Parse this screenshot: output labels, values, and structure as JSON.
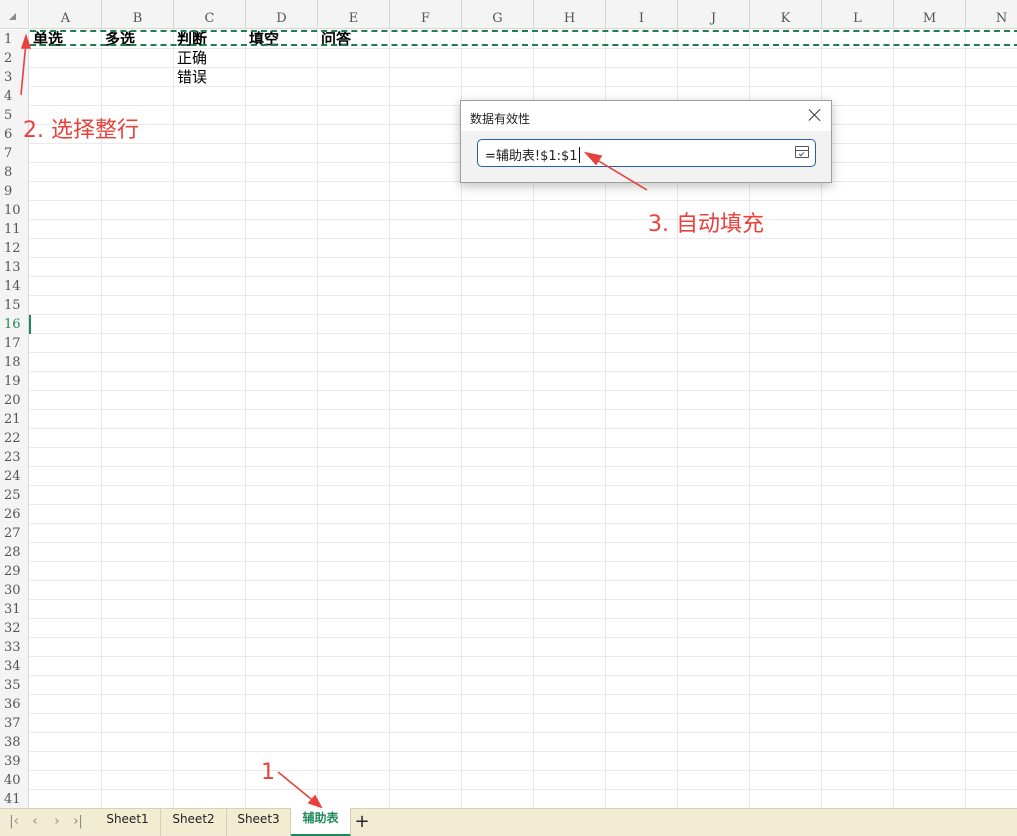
{
  "columns": [
    "A",
    "B",
    "C",
    "D",
    "E",
    "F",
    "G",
    "H",
    "I",
    "J",
    "K",
    "L",
    "M",
    "N"
  ],
  "rows": [
    "1",
    "2",
    "3",
    "4",
    "5",
    "6",
    "7",
    "8",
    "9",
    "10",
    "11",
    "12",
    "13",
    "14",
    "15",
    "16",
    "17",
    "18",
    "19",
    "20",
    "21",
    "22",
    "23",
    "24",
    "25",
    "26",
    "27",
    "28",
    "29",
    "30",
    "31",
    "32",
    "33",
    "34",
    "35",
    "36",
    "37",
    "38",
    "39",
    "40",
    "41"
  ],
  "active_row": "16",
  "cells": {
    "A1": "单选",
    "B1": "多选",
    "C1": "判断",
    "D1": "填空",
    "E1": "问答",
    "C2": "正确",
    "C3": "错误"
  },
  "dialog": {
    "title": "数据有效性",
    "reference": "=辅助表!$1:$1"
  },
  "annotations": {
    "step1": "1",
    "step2": "2. 选择整行",
    "step3": "3. 自动填充",
    "color": "#e8413c"
  },
  "sheet_tabs": [
    "Sheet1",
    "Sheet2",
    "Sheet3",
    "辅助表"
  ],
  "active_tab": "辅助表",
  "nav_icons": [
    "first-sheet-icon",
    "prev-sheet-icon",
    "next-sheet-icon",
    "last-sheet-icon"
  ],
  "add_sheet_label": "+",
  "accent_color": "#1e8a5a"
}
